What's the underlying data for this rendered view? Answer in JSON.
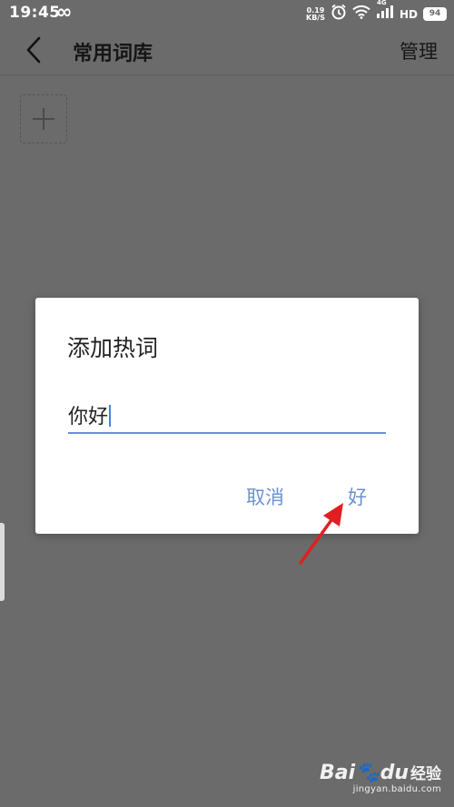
{
  "status_bar": {
    "time": "19:45",
    "infinity_symbol": "∞",
    "net_speed_value": "0.19",
    "net_speed_unit": "KB/S",
    "signal_label": "4G",
    "hd_label": "HD",
    "battery_level": "94",
    "icons": [
      "alarm-icon",
      "wifi-icon",
      "signal-icon"
    ]
  },
  "app_bar": {
    "title": "常用词库",
    "manage_label": "管理",
    "back_icon": "chevron-left-icon"
  },
  "content": {
    "add_tile_icon": "plus-icon"
  },
  "dialog": {
    "title": "添加热词",
    "input_value": "你好",
    "cancel_label": "取消",
    "ok_label": "好"
  },
  "watermark": {
    "logo": "Bai",
    "logo_suffix": "du",
    "brand_cn": "经验",
    "url": "jingyan.baidu.com"
  },
  "colors": {
    "overlay_background": "#6b6b6b",
    "dialog_button": "#6e90d4",
    "input_underline": "#6b8fd6",
    "annotation_arrow": "#e02020"
  }
}
